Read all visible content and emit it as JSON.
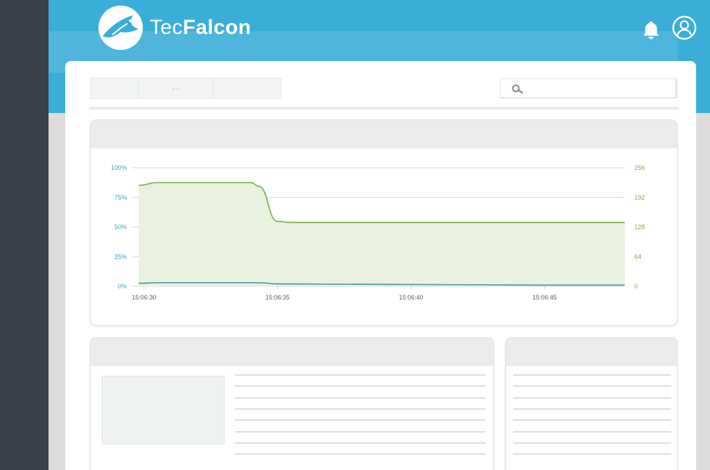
{
  "brand": {
    "name_light": "Tec",
    "name_bold": "Falcon"
  },
  "header": {
    "notifications_icon": "bell-icon",
    "profile_icon": "user-circle-icon"
  },
  "toolbar": {
    "tabs": [
      {
        "label": ""
      },
      {
        "label": "- -"
      },
      {
        "label": ""
      }
    ],
    "search": {
      "placeholder": "",
      "icon": "search-icon"
    }
  },
  "colors": {
    "header": "#3aaed8",
    "rail": "#3b424b",
    "series_green": "#7fb25a",
    "series_blue": "#4f9fb2",
    "axis_left": "#3a9fc4",
    "axis_right": "#72ad4c"
  },
  "chart_data": {
    "type": "area",
    "x_ticks": [
      "15:06:30",
      "15:06:35",
      "15:06:40",
      "15:06:45"
    ],
    "y_left_ticks": [
      "0%",
      "25%",
      "50%",
      "75%",
      "100%"
    ],
    "y_right_ticks": [
      "0",
      "64",
      "128",
      "192",
      "256"
    ],
    "y_left_range": [
      0,
      100
    ],
    "y_right_range": [
      0,
      256
    ],
    "grid": true,
    "series": [
      {
        "axis": "right",
        "color": "#7fb25a",
        "fill": true,
        "points": [
          {
            "t": "15:06:29.8",
            "v": 218
          },
          {
            "t": "15:06:30.5",
            "v": 224
          },
          {
            "t": "15:06:34.0",
            "v": 224
          },
          {
            "t": "15:06:34.3",
            "v": 216
          },
          {
            "t": "15:06:35.0",
            "v": 140
          },
          {
            "t": "15:06:35.5",
            "v": 138
          },
          {
            "t": "15:06:48.0",
            "v": 138
          }
        ]
      },
      {
        "axis": "left",
        "color": "#4f9fb2",
        "fill": false,
        "points": [
          {
            "t": "15:06:29.8",
            "v": 2.5
          },
          {
            "t": "15:06:30.5",
            "v": 3
          },
          {
            "t": "15:06:34.3",
            "v": 3
          },
          {
            "t": "15:06:35.0",
            "v": 2
          },
          {
            "t": "15:06:40.0",
            "v": 1.5
          },
          {
            "t": "15:06:45.0",
            "v": 1
          },
          {
            "t": "15:06:48.0",
            "v": 1
          }
        ]
      }
    ]
  },
  "info_card": {
    "lines": 8
  },
  "side_card": {
    "lines": 8
  }
}
